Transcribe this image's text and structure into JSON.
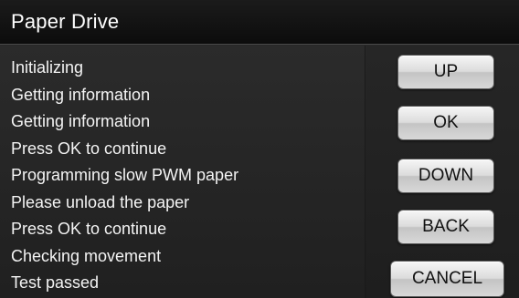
{
  "title": "Paper Drive",
  "log_lines": [
    "Initializing",
    "Getting information",
    "Getting information",
    "Press OK to continue",
    "Programming slow PWM paper",
    "Please unload the paper",
    "Press OK to continue",
    "Checking movement",
    "Test passed"
  ],
  "buttons": {
    "up": "UP",
    "ok": "OK",
    "down": "DOWN",
    "back": "BACK",
    "cancel": "CANCEL"
  }
}
